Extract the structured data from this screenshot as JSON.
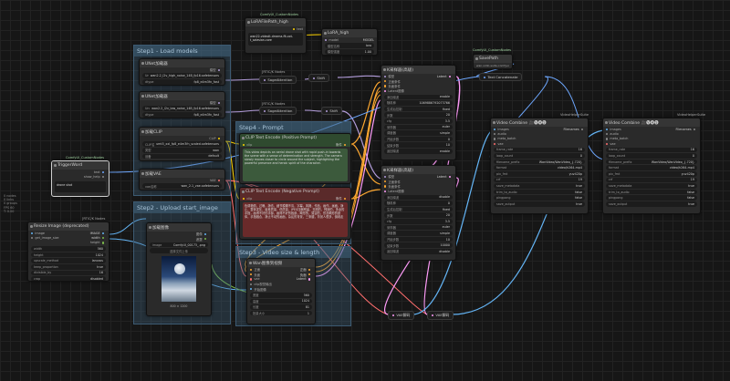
{
  "colors": {
    "model": "#b39ddb",
    "clip": "#ffd500",
    "conditioning": "#ffa931",
    "latent": "#ff9cf9",
    "image": "#64b5f6",
    "vae": "#ff6e6e",
    "int": "#7cbb4c",
    "wire_blue": "#6ea8ff"
  },
  "groups": {
    "step1": "Step1 - Load models",
    "step2": "Step2 - Upload start_image",
    "step3": "Step3 - Video size & length",
    "step4": "Step4 - Prompt"
  },
  "badges": {
    "custom_nodes_1": "ComfyUI_CustomNodes",
    "custom_nodes_2": "ComfyUI_CustomNodes",
    "custom_nodes_3": "ComfyUI_CustomNodes",
    "kj_nodes_1": "[RTIC/K Nodes",
    "kj_nodes_2": "[RTIC/K Nodes",
    "kj_nodes_3": "[RTIC/K Nodes",
    "vhs_1": "VideoHelperSuite",
    "vhs_2": "VideoHelperSuite",
    "kj_resize": "[RTIC/K Nodes"
  },
  "lorafilepath": {
    "title": "LoRAFilePath_high",
    "text_label": "text",
    "text_value": "wan22-videolt-drrama-fit-xxt-t_salesian-core"
  },
  "lora_high": {
    "title": "LoRA_high",
    "in1": "model",
    "in2": "lora_name",
    "out": "MODEL",
    "w1_k": "模型名称",
    "w1_v": "lora",
    "w2_k": "模型强度",
    "w2_v": "1.00"
  },
  "unet1": {
    "title": "UNet加载器",
    "out": "模型",
    "w1_k": "Unet",
    "w1_v": "wan2.2_i2v_high_noise_14B_fp16.safetensors",
    "w2_k": "dtype",
    "w2_v": "fp8_e4m3fn_fast"
  },
  "unet2": {
    "title": "UNet加载器",
    "out": "模型",
    "w1_k": "Unet",
    "w1_v": "wan2.2_i2v_low_noise_14B_fp16.safetensors",
    "w2_k": "dtype",
    "w2_v": "fp8_e4m3fn_fast"
  },
  "clip_loader": {
    "title": "加载CLIP",
    "out": "CLIP",
    "w1_k": "CLIP名称",
    "w1_v": "umt5_xxl_fp8_e4m3fn_scaled.safetensors",
    "w2_k": "类型",
    "w2_v": "wan",
    "w3_k": "设备",
    "w3_v": "default"
  },
  "vae_loader": {
    "title": "加载VAE",
    "out": "VAE",
    "w1_k": "vae名称",
    "w1_v": "wan_2.1_vae.safetensors"
  },
  "trigger": {
    "title": "TriggerWord",
    "out1": "text",
    "out2": "show_help",
    "text": "drone shot"
  },
  "sage1": {
    "title": "SageAttention"
  },
  "sage2": {
    "title": "SageAttention"
  },
  "shift1": {
    "title": "Shift"
  },
  "shift2": {
    "title": "Shift"
  },
  "pos_prompt": {
    "title": "CLIP Text Encode (Positive Prompt)",
    "in": "clip",
    "out": "条件",
    "text": "This video depicts an aerial drone shot with rapid push-in towards the scene with a sense of determination and strength. The camera slowly moves closer to circle around the subject, highlighting the powerful presence and heroic spirit of the character."
  },
  "neg_prompt": {
    "title": "CLIP Text Encode (Negative Prompt)",
    "in": "clip",
    "out": "条件",
    "text": "色调艳丽，过曝，静态，细节模糊不清，字幕，风格，作品，画作，画面，静止，整体发灰，最差质量，低质量，JPEG压缩残留，丑陋的，残缺的，多余的手指，画得不好的手部，画得不好的脸部，畸形的，毁容的，形态畸形的肢体，手指融合，静止不动的画面，杂乱的背景，三条腿，背景人很多，倒着走"
  },
  "load_image": {
    "title": "加载图像",
    "out1": "图像",
    "out2": "遮罩",
    "w1_k": "image",
    "w1_v": "ComfyUI_00173_.png",
    "w2": "选择文件上传",
    "caption": "800 × 1200"
  },
  "resize": {
    "title": "Resize Image (deprecated)",
    "in1": "image",
    "in2": "get_image_size",
    "out1": "IMAGE",
    "out2": "width",
    "out3": "height",
    "rows": [
      [
        "width",
        "560"
      ],
      [
        "height",
        "1024"
      ],
      [
        "upscale_method",
        "lanczos"
      ],
      [
        "keep_proportion",
        "true"
      ],
      [
        "divisible_by",
        "16"
      ],
      [
        "crop",
        "disabled"
      ]
    ]
  },
  "wan_i2v": {
    "title": "Wan图像到视频",
    "in": [
      "正面",
      "负面",
      "vae",
      "clip视觉输出",
      "开始图像"
    ],
    "out": [
      "正面",
      "负面",
      "Latent"
    ],
    "rows": [
      [
        "宽度",
        "560"
      ],
      [
        "高度",
        "1024"
      ],
      [
        "长度",
        "81"
      ],
      [
        "批量大小",
        "1"
      ]
    ]
  },
  "ksampler1": {
    "title": "K采样器(高级)",
    "in": [
      "模型",
      "正面条件",
      "负面条件",
      "Latent图像"
    ],
    "out": "Latent",
    "rows": [
      [
        "添加噪波",
        "enable"
      ],
      [
        "随机种",
        "1069886792073766"
      ],
      [
        "生成后控制",
        "fixed"
      ],
      [
        "步数",
        "20"
      ],
      [
        "cfg",
        "3.5"
      ],
      [
        "采样器",
        "euler"
      ],
      [
        "调度器",
        "simple"
      ],
      [
        "开始步数",
        "0"
      ],
      [
        "结束步数",
        "10"
      ],
      [
        "返回噪波",
        "enable"
      ]
    ]
  },
  "ksampler2": {
    "title": "K采样器(高级)",
    "in": [
      "模型",
      "正面条件",
      "负面条件",
      "Latent图像"
    ],
    "out": "Latent",
    "rows": [
      [
        "添加噪波",
        "disable"
      ],
      [
        "随机种",
        "0"
      ],
      [
        "生成后控制",
        "fixed"
      ],
      [
        "步数",
        "20"
      ],
      [
        "cfg",
        "3.5"
      ],
      [
        "采样器",
        "euler"
      ],
      [
        "调度器",
        "simple"
      ],
      [
        "开始步数",
        "10"
      ],
      [
        "结束步数",
        "10000"
      ],
      [
        "返回噪波",
        "disable"
      ]
    ]
  },
  "save_path": {
    "title": "SavePath",
    "out": "wan-vidlo-suite-comfyui"
  },
  "text_concat": {
    "title": "Text Concatenate"
  },
  "vae_decode1": {
    "title": "VAE解码"
  },
  "vae_decode2": {
    "title": "VAE解码"
  },
  "video_combine1": {
    "title": "Video Combine 🎥🅥🅗🅢",
    "in": [
      "images",
      "audio",
      "meta_batch",
      "vae"
    ],
    "out": "Filenames",
    "rows": [
      [
        "frame_rate",
        "16"
      ],
      [
        "loop_count",
        "0"
      ],
      [
        "filename_prefix",
        "WanVideo/WanVideo_{.720}"
      ],
      [
        "format",
        "video/h264-mp4"
      ],
      [
        "pix_fmt",
        "yuv420p"
      ],
      [
        "crf",
        "19"
      ],
      [
        "save_metadata",
        "true"
      ],
      [
        "trim_to_audio",
        "false"
      ],
      [
        "pingpong",
        "false"
      ],
      [
        "save_output",
        "true"
      ]
    ]
  },
  "video_combine2": {
    "title": "Video Combine 🎥🅥🅗🅢",
    "in": [
      "images",
      "audio",
      "meta_batch",
      "vae"
    ],
    "out": "Filenames",
    "rows": [
      [
        "frame_rate",
        "16"
      ],
      [
        "loop_count",
        "0"
      ],
      [
        "filename_prefix",
        "WanVideo/WanVideo_{.720}"
      ],
      [
        "format",
        "video/h264-mp4"
      ],
      [
        "pix_fmt",
        "yuv420p"
      ],
      [
        "crf",
        "19"
      ],
      [
        "save_metadata",
        "true"
      ],
      [
        "trim_to_audio",
        "false"
      ],
      [
        "pingpong",
        "false"
      ],
      [
        "save_output",
        "true"
      ]
    ]
  },
  "side_notes": [
    "0 nodes",
    "0 links",
    "0 groups",
    "FPS 60",
    "T: 0.00"
  ]
}
